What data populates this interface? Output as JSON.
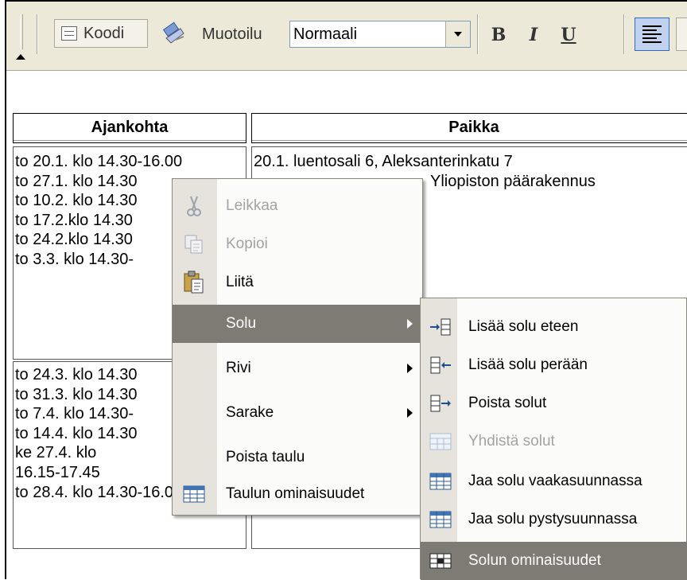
{
  "toolbar": {
    "code_label": "Koodi",
    "format_label": "Muotoilu",
    "format_value": "Normaali",
    "bold_label": "B",
    "italic_label": "I",
    "underline_label": "U"
  },
  "table": {
    "headers": [
      "Ajankohta",
      "Paikka"
    ],
    "col1_block1": [
      "to 20.1. klo 14.30-16.00",
      "to 27.1. klo 14.30",
      "to 10.2. klo 14.30",
      "to 17.2.klo 14.30",
      "to 24.2.klo 14.30",
      "to 3.3. klo 14.30-"
    ],
    "col2_block1": [
      "20.1. luentosali 6, Aleksanterinkatu 7",
      "Yliopiston päärakennus"
    ],
    "col1_block2": [
      "to 24.3. klo 14.30",
      "to 31.3. klo 14.30",
      "to 7.4. klo 14.30-",
      "to 14.4. klo 14.30",
      "ke 27.4. klo",
      "16.15-17.45",
      "to 28.4. klo 14.30-16.00"
    ]
  },
  "context_menu": {
    "items": [
      {
        "label": "Leikkaa",
        "icon": "scissors-icon",
        "enabled": false
      },
      {
        "label": "Kopioi",
        "icon": "copy-icon",
        "enabled": false
      },
      {
        "label": "Liitä",
        "icon": "paste-icon",
        "enabled": true
      },
      {
        "label": "Solu",
        "icon": "",
        "enabled": true,
        "submenu": true,
        "highlighted": true
      },
      {
        "label": "Rivi",
        "icon": "",
        "enabled": true,
        "submenu": true
      },
      {
        "label": "Sarake",
        "icon": "",
        "enabled": true,
        "submenu": true
      },
      {
        "label": "Poista taulu",
        "icon": "",
        "enabled": true
      },
      {
        "label": "Taulun ominaisuudet",
        "icon": "table-properties-icon",
        "enabled": true
      }
    ]
  },
  "cell_submenu": {
    "items": [
      {
        "label": "Lisää solu eteen",
        "icon": "insert-cell-before-icon",
        "enabled": true
      },
      {
        "label": "Lisää solu perään",
        "icon": "insert-cell-after-icon",
        "enabled": true
      },
      {
        "label": "Poista solut",
        "icon": "delete-cells-icon",
        "enabled": true
      },
      {
        "label": "Yhdistä solut",
        "icon": "merge-cells-icon",
        "enabled": false
      },
      {
        "label": "Jaa solu vaakasuunnassa",
        "icon": "split-horizontal-icon",
        "enabled": true
      },
      {
        "label": "Jaa solu pystysuunnassa",
        "icon": "split-vertical-icon",
        "enabled": true
      },
      {
        "label": "Solun ominaisuudet",
        "icon": "cell-properties-icon",
        "enabled": true,
        "highlighted": true
      }
    ]
  }
}
